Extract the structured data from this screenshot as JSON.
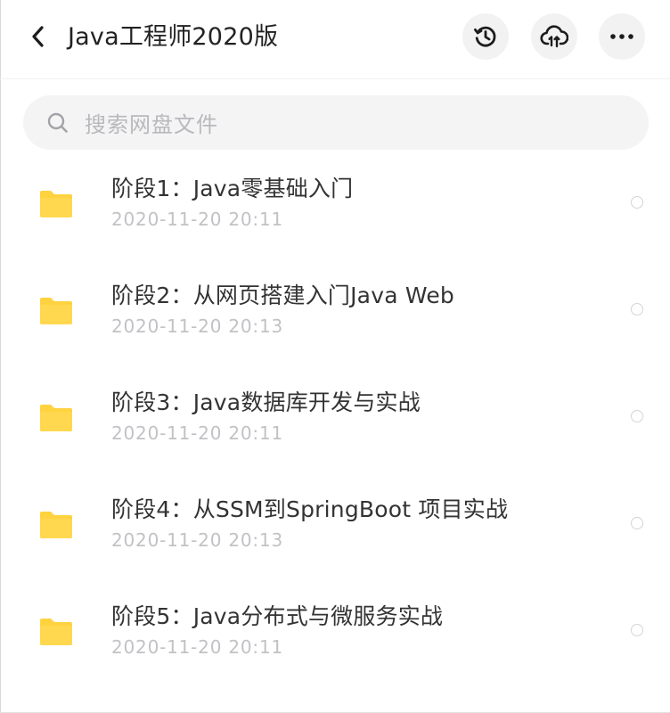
{
  "header": {
    "title": "Java工程师2020版",
    "back_icon": "chevron-left-icon",
    "actions": [
      {
        "name": "history",
        "icon": "history-icon"
      },
      {
        "name": "cloud-upload",
        "icon": "cloud-upload-icon"
      },
      {
        "name": "more",
        "icon": "more-horizontal-icon"
      }
    ]
  },
  "search": {
    "placeholder": "搜索网盘文件",
    "icon": "search-icon"
  },
  "folders": [
    {
      "name": "阶段1：Java零基础入门",
      "date": "2020-11-20  20:11",
      "icon": "folder-icon"
    },
    {
      "name": "阶段2：从网页搭建入门Java Web",
      "date": "2020-11-20  20:13",
      "icon": "folder-icon"
    },
    {
      "name": "阶段3：Java数据库开发与实战",
      "date": "2020-11-20  20:11",
      "icon": "folder-icon"
    },
    {
      "name": "阶段4：从SSM到SpringBoot 项目实战",
      "date": "2020-11-20  20:13",
      "icon": "folder-icon"
    },
    {
      "name": "阶段5：Java分布式与微服务实战",
      "date": "2020-11-20  20:11",
      "icon": "folder-icon"
    }
  ],
  "colors": {
    "folder": "#FFD23F",
    "folder_dark": "#F7C520",
    "button_bg": "#F2F2F3",
    "date_text": "#C2C2C6",
    "placeholder": "#B9B9BD"
  }
}
